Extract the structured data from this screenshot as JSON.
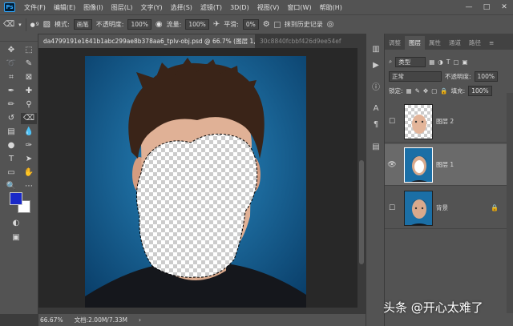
{
  "menubar": {
    "logo": "Ps",
    "items": [
      "文件(F)",
      "编辑(E)",
      "图像(I)",
      "图层(L)",
      "文字(Y)",
      "选择(S)",
      "滤镜(T)",
      "3D(D)",
      "视图(V)",
      "窗口(W)",
      "帮助(H)"
    ],
    "window_controls": [
      "—",
      "□",
      "✕"
    ]
  },
  "options": {
    "brush_size": "9",
    "mode_label": "模式:",
    "mode_value": "画笔",
    "opacity_label": "不透明度:",
    "opacity_value": "100%",
    "flow_label": "流量:",
    "flow_value": "100%",
    "smooth_label": "平滑:",
    "smooth_value": "0%",
    "erase_history_label": "抹到历史记录"
  },
  "tabs": [
    {
      "label": "da4799191e1641b1abc299ae8b378aa6_tplv-obj.psd @ 66.7% (图层 1, RGB/8) *",
      "close": "×"
    },
    {
      "label": "30c8840fcbbf426d9ee54ef"
    }
  ],
  "status": {
    "zoom": "66.67%",
    "doc": "文档:2.00M/7.33M"
  },
  "panel": {
    "tabs": [
      "调整",
      "图层",
      "属性",
      "通道",
      "路径"
    ],
    "kind_value": "类型",
    "blend_value": "正常",
    "opacity_label": "不透明度:",
    "opacity_value": "100%",
    "lock_label": "锁定:",
    "fill_label": "填充:",
    "fill_value": "100%",
    "layers": [
      {
        "name": "图层 2",
        "visible": false,
        "selected": false
      },
      {
        "name": "图层 1",
        "visible": true,
        "selected": true
      },
      {
        "name": "背景",
        "visible": false,
        "selected": false,
        "locked": true
      }
    ]
  },
  "watermark": "头条 @开心太难了",
  "colors": {
    "foreground": "#1a29c8",
    "background": "#ffffff",
    "photo_bg": "#1b6fa6",
    "ui_panel": "#535353"
  }
}
